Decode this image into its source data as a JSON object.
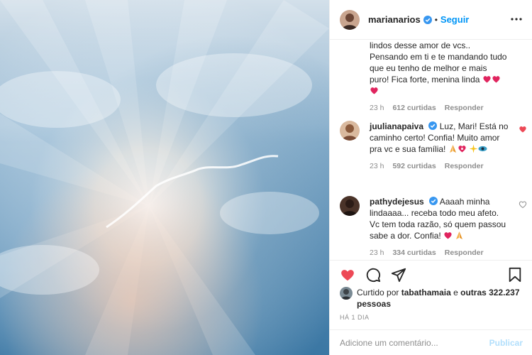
{
  "header": {
    "username": "marianarios",
    "separator": "•",
    "follow_label": "Seguir",
    "avatar_icon": "profile-avatar",
    "more_icon": "more-options-icon"
  },
  "comments": [
    {
      "username": "",
      "text": "lindos desse amor de vcs.. Pensando em ti e te mandando tudo que eu tenho de melhor e mais puro! Fica forte, menina linda",
      "emojis": [
        "red-heart",
        "red-heart",
        "red-heart"
      ],
      "time": "23 h",
      "likes": "612 curtidas",
      "reply": "Responder",
      "liked": false
    },
    {
      "username": "juulianapaiva",
      "text": "Luz, Mari! Está no caminho certo! Confia! Muito amor pra vc e sua família!",
      "emojis": [
        "praying-hands",
        "mending-heart",
        "sparkle",
        "eyes"
      ],
      "time": "23 h",
      "likes": "592 curtidas",
      "reply": "Responder",
      "liked": true
    },
    {
      "username": "pathydejesus",
      "text": "Aaaah minha lindaaaa... receba todo meu afeto. Vc tem toda razão, só quem passou sabe a dor. Confia!",
      "emojis": [
        "red-heart",
        "praying-hands"
      ],
      "time": "23 h",
      "likes": "334 curtidas",
      "reply": "Responder",
      "liked": false
    }
  ],
  "actions": {
    "like_icon": "heart-filled-icon",
    "comment_icon": "comment-icon",
    "share_icon": "share-icon",
    "save_icon": "bookmark-icon"
  },
  "liked_by": {
    "prefix": "Curtido por",
    "user": "tabathamaia",
    "connector": "e",
    "others": "outras 322.237 pessoas"
  },
  "post_time": "HÁ 1 DIA",
  "add_comment": {
    "placeholder": "Adicione um comentário...",
    "publish_label": "Publicar"
  },
  "colors": {
    "accent": "#0095f6",
    "like_red": "#ed4956",
    "muted": "#8e8e8e",
    "publish_disabled": "#b2dffc"
  }
}
